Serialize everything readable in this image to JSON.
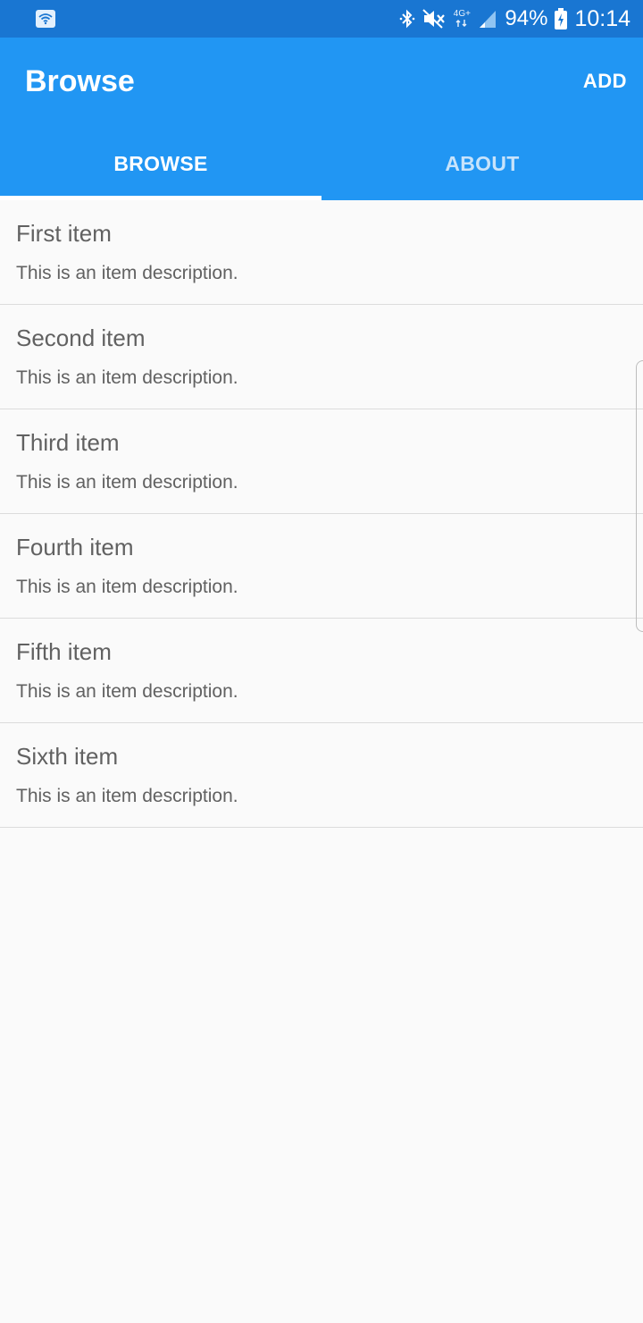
{
  "status_bar": {
    "left_icon": "wifi-icon",
    "icons": [
      "bluetooth-icon",
      "mute-icon",
      "signal-icon"
    ],
    "network_label": "4G+",
    "battery_percent": "94%",
    "time": "10:14"
  },
  "app_bar": {
    "title": "Browse",
    "add_label": "ADD",
    "color": "#2196f3"
  },
  "tabs": [
    {
      "label": "BROWSE",
      "selected": true
    },
    {
      "label": "ABOUT",
      "selected": false
    }
  ],
  "items": [
    {
      "title": "First item",
      "description": "This is an item description."
    },
    {
      "title": "Second item",
      "description": "This is an item description."
    },
    {
      "title": "Third item",
      "description": "This is an item description."
    },
    {
      "title": "Fourth item",
      "description": "This is an item description."
    },
    {
      "title": "Fifth item",
      "description": "This is an item description."
    },
    {
      "title": "Sixth item",
      "description": "This is an item description."
    }
  ]
}
